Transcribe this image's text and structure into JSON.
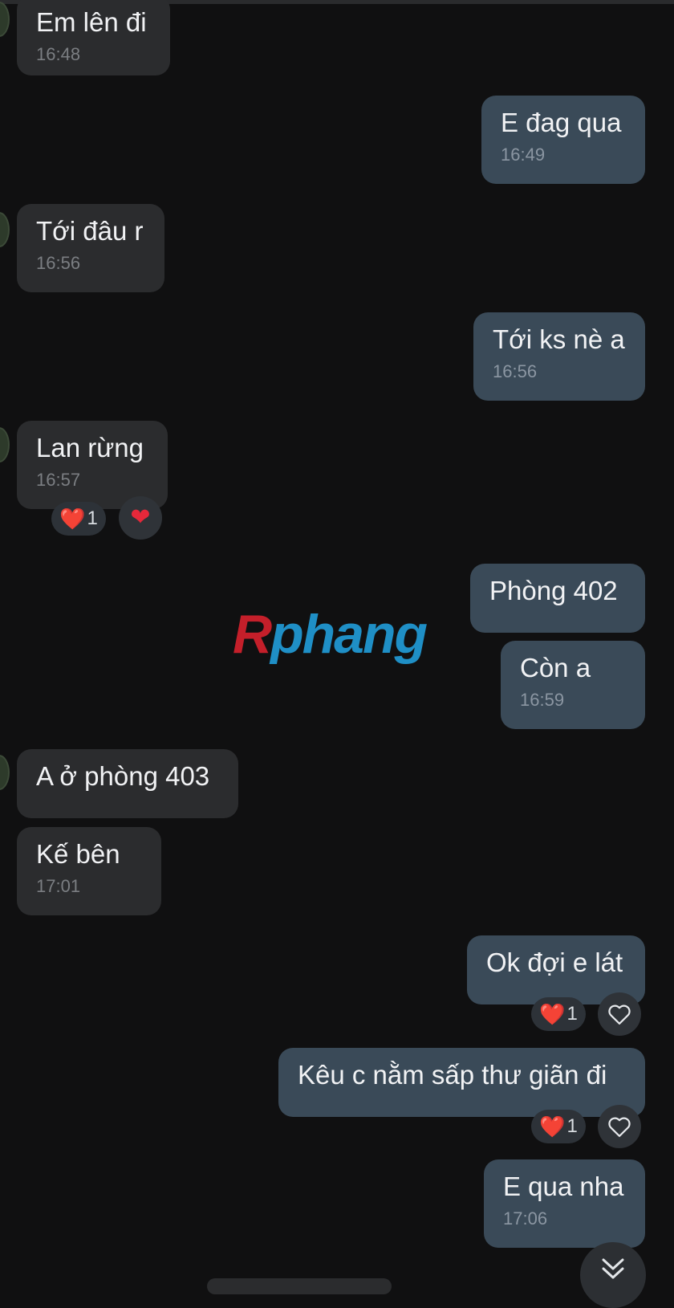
{
  "messages": [
    {
      "text": "Em lên đi",
      "time": "16:48"
    },
    {
      "text": "E đag qua",
      "time": "16:49"
    },
    {
      "text": "Tới đâu r",
      "time": "16:56"
    },
    {
      "text": "Tới ks nè a",
      "time": "16:56"
    },
    {
      "text": "Lan rừng",
      "time": "16:57"
    },
    {
      "text": "Phòng 402"
    },
    {
      "text": "Còn a",
      "time": "16:59"
    },
    {
      "text": "A ở phòng 403"
    },
    {
      "text": "Kế bên",
      "time": "17:01"
    },
    {
      "text": "Ok đợi e lát"
    },
    {
      "text": "Kêu c nằm sấp thư giãn đi"
    },
    {
      "text": "E qua nha",
      "time": "17:06"
    }
  ],
  "reactions": {
    "lan_rung": {
      "emoji": "❤️",
      "count": "1"
    },
    "ok_doi": {
      "emoji": "❤️",
      "count": "1"
    },
    "keu_c": {
      "emoji": "❤️",
      "count": "1"
    }
  },
  "watermark": {
    "first": "R",
    "rest": "phang"
  },
  "colors": {
    "background": "#101011",
    "incoming_bubble": "#2b2c2e",
    "outgoing_bubble": "#3a4a58",
    "heart": "#e5283a"
  },
  "icons": {
    "reaction_add_outline": "heart-outline-icon",
    "reaction_added": "heart-icon",
    "scroll_down": "chevron-double-down-icon"
  }
}
